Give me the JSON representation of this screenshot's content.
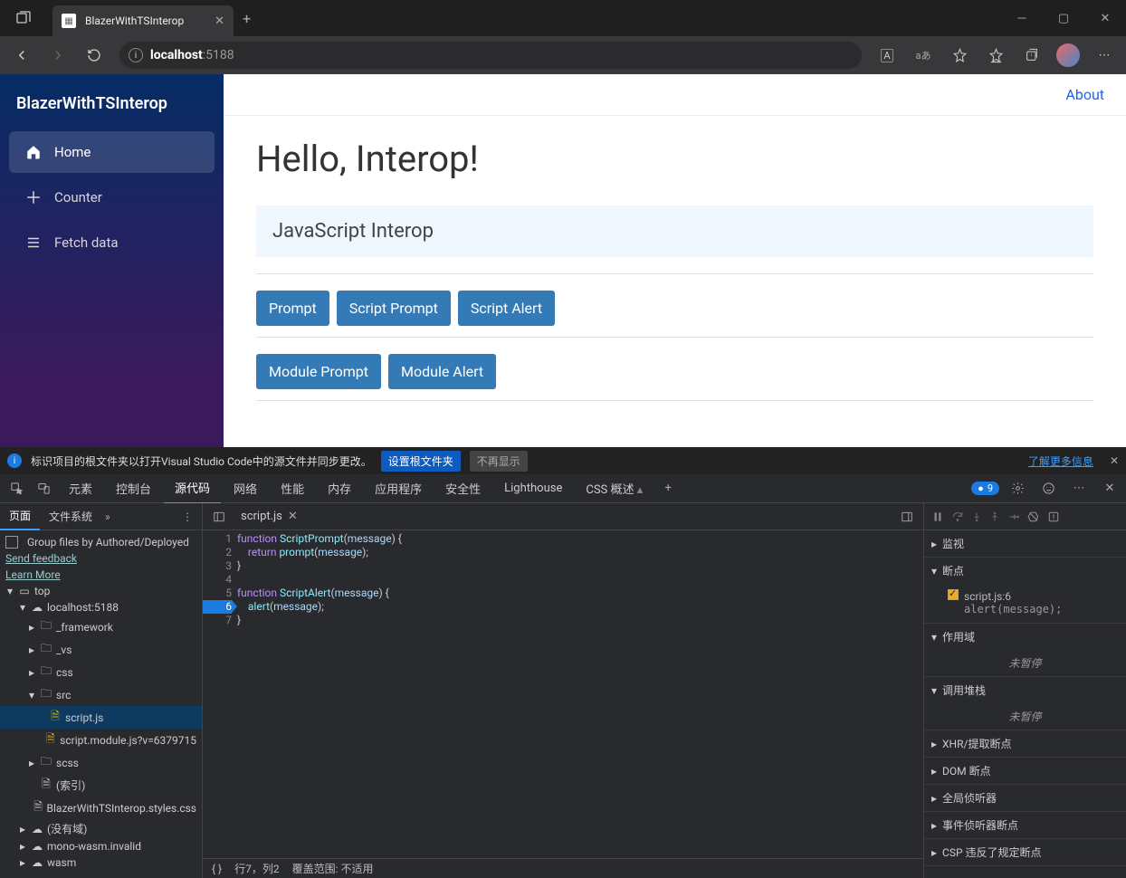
{
  "window": {
    "tab_title": "BlazerWithTSInterop",
    "plus": "+"
  },
  "addressbar": {
    "host": "localhost",
    "port": ":5188",
    "a_badge": "A",
    "lang_badge": "aあ"
  },
  "app": {
    "brand": "BlazerWithTSInterop",
    "nav": {
      "home": "Home",
      "counter": "Counter",
      "fetch": "Fetch data"
    },
    "about": "About",
    "hello": "Hello, Interop!",
    "card_title": "JavaScript Interop",
    "buttons": {
      "prompt": "Prompt",
      "script_prompt": "Script Prompt",
      "script_alert": "Script Alert",
      "module_prompt": "Module Prompt",
      "module_alert": "Module Alert"
    }
  },
  "infobar": {
    "text": "标识项目的根文件夹以打开Visual Studio Code中的源文件并同步更改。",
    "set_root": "设置根文件夹",
    "dont_show": "不再显示",
    "learn_more": "了解更多信息"
  },
  "devtabs": {
    "elements": "元素",
    "console": "控制台",
    "sources": "源代码",
    "network": "网络",
    "performance": "性能",
    "memory": "内存",
    "application": "应用程序",
    "security": "安全性",
    "lighthouse": "Lighthouse",
    "css_overview": "CSS 概述",
    "badge": "9"
  },
  "filepane": {
    "tab_page": "页面",
    "tab_filesystem": "文件系统",
    "group_by": "Group files by Authored/Deployed",
    "send_feedback": "Send feedback",
    "learn_more": "Learn More",
    "tree": {
      "top": "top",
      "host": "localhost:5188",
      "framework": "_framework",
      "vs": "_vs",
      "css": "css",
      "src": "src",
      "scriptjs": "script.js",
      "scriptmod": "script.module.js?v=6379715",
      "scss": "scss",
      "index": "(索引)",
      "styles": "BlazerWithTSInterop.styles.css",
      "nodomain": "(没有域)",
      "mono": "mono-wasm.invalid",
      "wasm": "wasm"
    }
  },
  "code": {
    "tab": "script.js",
    "lines": {
      "l1_a": "function ",
      "l1_b": "ScriptPrompt",
      "l1_c": "(",
      "l1_d": "message",
      "l1_e": ") {",
      "l2_a": "    return ",
      "l2_b": "prompt",
      "l2_c": "(",
      "l2_d": "message",
      "l2_e": ");",
      "l3": "}",
      "l4": "",
      "l5_a": "function ",
      "l5_b": "ScriptAlert",
      "l5_c": "(",
      "l5_d": "message",
      "l5_e": ") {",
      "l6_a": "    ",
      "l6_b": "alert",
      "l6_c": "(",
      "l6_d": "message",
      "l6_e": ");",
      "l7": "}"
    },
    "status_curly": "{ }",
    "status_line": "行7，列2",
    "status_cov": "覆盖范围: 不适用"
  },
  "debug": {
    "watch": "监视",
    "breakpoints": "断点",
    "bp_file": "script.js:6",
    "bp_code": "alert(message);",
    "scope": "作用域",
    "not_paused": "未暂停",
    "callstack": "调用堆栈",
    "xhr": "XHR/提取断点",
    "dom": "DOM 断点",
    "global": "全局侦听器",
    "event": "事件侦听器断点",
    "csp": "CSP 违反了规定断点"
  }
}
